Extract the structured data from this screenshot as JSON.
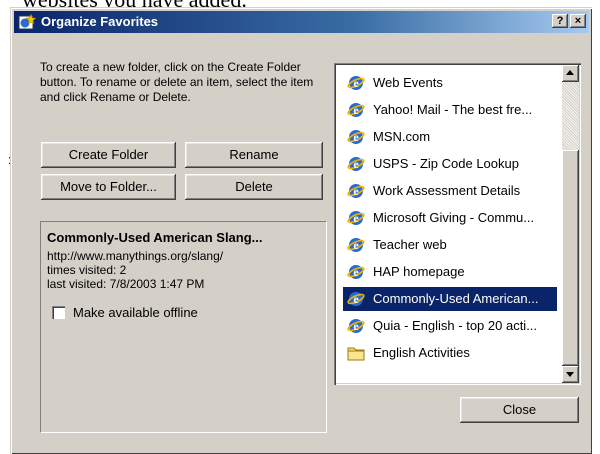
{
  "background": {
    "text": "websites you have added."
  },
  "window": {
    "title": "Organize Favorites",
    "help_label": "?",
    "close_label": "×"
  },
  "instructions": "To create a new folder, click on the Create Folder button. To rename or delete an item, select the item and click Rename or Delete.",
  "buttons": {
    "create_folder": "Create Folder",
    "rename": "Rename",
    "move_to_folder": "Move to Folder...",
    "delete": "Delete",
    "close": "Close"
  },
  "details": {
    "title": "Commonly-Used American Slang...",
    "url": "http://www.manythings.org/slang/",
    "times_visited": "times visited: 2",
    "last_visited": "last visited: 7/8/2003 1:47 PM",
    "offline_label": "Make available offline",
    "offline_checked": false
  },
  "favorites": [
    {
      "label": "Web Events",
      "icon": "ie-icon"
    },
    {
      "label": "Yahoo! Mail - The best fre...",
      "icon": "ie-icon"
    },
    {
      "label": "MSN.com",
      "icon": "ie-icon"
    },
    {
      "label": "USPS - Zip Code Lookup",
      "icon": "ie-icon"
    },
    {
      "label": "Work Assessment Details",
      "icon": "ie-icon"
    },
    {
      "label": "Microsoft Giving - Commu...",
      "icon": "ie-icon"
    },
    {
      "label": "Teacher web",
      "icon": "ie-icon"
    },
    {
      "label": "HAP homepage",
      "icon": "ie-icon"
    },
    {
      "label": "Commonly-Used American...",
      "icon": "ie-icon",
      "selected": true
    },
    {
      "label": "Quia - English - top 20 acti...",
      "icon": "ie-icon"
    },
    {
      "label": "English Activities",
      "icon": "folder-icon"
    }
  ],
  "colors": {
    "titlebar": "#0a246a",
    "selection": "#0a246a",
    "face": "#d4d0c8"
  }
}
